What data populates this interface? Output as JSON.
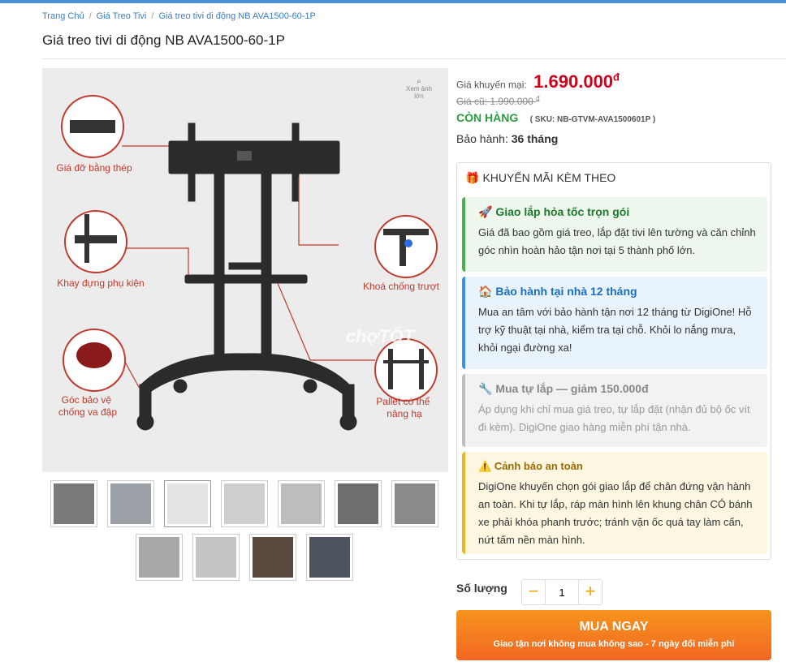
{
  "breadcrumb": {
    "home": "Trang Chủ",
    "category": "Giá Treo Tivi",
    "current": "Giá treo tivi di động NB AVA1500-60-1P"
  },
  "product": {
    "title": "Giá treo tivi di động NB AVA1500-60-1P",
    "zoom_label": "Xem ảnh lớn",
    "image_labels": {
      "top_left": "Giá đỡ bằng thép",
      "mid_left": "Khay đựng phụ kiện",
      "bottom_left": "Góc bảo vệ chống va đập",
      "mid_right": "Khoá chống trượt",
      "bottom_right": "Pallet có thể nâng hạ",
      "watermark": "chợTỐT"
    }
  },
  "pricing": {
    "sale_label": "Giá khuyến mại:",
    "sale_price": "1.690.000",
    "currency": "đ",
    "old_price_label": "Giá cũ:",
    "old_price": "1.990.000",
    "stock": "CÒN HÀNG",
    "sku": "( SKU: NB-GTVM-AVA1500601P )",
    "warranty_label": "Bảo hành:",
    "warranty_value": "36 tháng"
  },
  "promo": {
    "header": "KHUYẾN MÃI KÈM THEO",
    "cards": [
      {
        "icon": "🚀",
        "title": "Giao lắp hỏa tốc trọn gói",
        "desc": "Giá đã bao gồm giá treo, lắp đặt tivi lên tường và căn chỉnh góc nhìn hoàn hảo tận nơi tại 5 thành phố lớn."
      },
      {
        "icon": "🏠",
        "title": "Bảo hành tại nhà 12 tháng",
        "desc": "Mua an tâm với bảo hành tận nơi 12 tháng từ DigiOne! Hỗ trợ kỹ thuật tại nhà, kiểm tra tại chỗ. Khỏi lo nắng mưa, khỏi ngại đường xa!"
      },
      {
        "icon": "🔧",
        "title": "Mua tự lắp — giảm 150.000đ",
        "desc": "Áp dụng khi chỉ mua giá treo, tự lắp đặt (nhận đủ bộ ốc vít đi kèm). DigiOne giao hàng miễn phí tận nhà."
      },
      {
        "icon": "⚠️",
        "title": "Cảnh báo an toàn",
        "desc": "DigiOne khuyến chọn gói giao lắp để chân đứng vận hành an toàn. Khi tự lắp, ráp màn hình lên khung chân CÓ bánh xe phải khóa phanh trước; tránh vặn ốc quá tay làm cấn, nứt tấm nền màn hình."
      }
    ]
  },
  "quantity": {
    "label": "Số lượng",
    "value": "1",
    "minus": "−",
    "plus": "+"
  },
  "buy": {
    "label": "MUA NGAY",
    "sub": "Giao tận nơi không mua không sao - 7 ngày đổi miễn phí"
  },
  "colors": {
    "accent_red": "#d0021b",
    "stock_green": "#2a9d3d",
    "buy_orange": "#f26722",
    "link_blue": "#3b7bc4"
  }
}
